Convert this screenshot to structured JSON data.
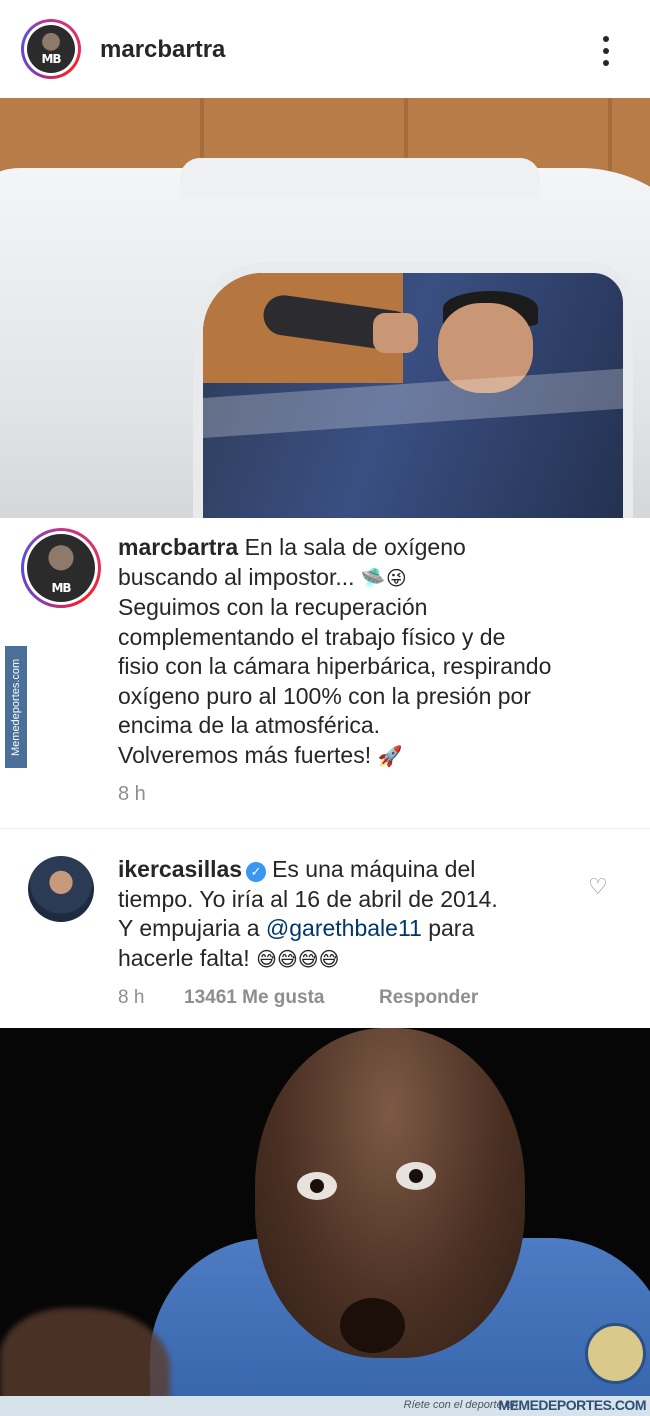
{
  "header": {
    "username": "marcbartra",
    "avatar_text": "MB",
    "more_icon": "more-vertical-icon"
  },
  "post": {
    "caption_username": "marcbartra",
    "caption_lines": [
      "En la sala de oxígeno",
      "buscando al impostor...",
      "Seguimos con la recuperación",
      "complementando el trabajo físico y de",
      "fisio con la cámara hiperbárica, respirando",
      "oxígeno puro al 100% con la presión por",
      "encima de la atmosférica.",
      "Volveremos más fuertes!"
    ],
    "emoji_1": "🛸😜",
    "emoji_2": "🚀",
    "time": "8 h"
  },
  "comment": {
    "username": "ikercasillas",
    "verified_icon": "verified-badge-icon",
    "text_1": "Es una máquina del",
    "text_2": "tiempo. Yo iría al 16 de abril de 2014.",
    "text_3": "Y empujaria a ",
    "mention": "@garethbale11",
    "text_4": " para",
    "text_5": "hacerle falta! ",
    "emojis": "😅😅😅😅",
    "time": "8 h",
    "likes": "13461 Me gusta",
    "reply": "Responder",
    "heart_icon": "heart-outline-icon"
  },
  "watermark": {
    "side": "Memedeportes.com",
    "tagline": "Ríete con el deporte en",
    "brand": "MEMEDEPORTES.COM"
  }
}
